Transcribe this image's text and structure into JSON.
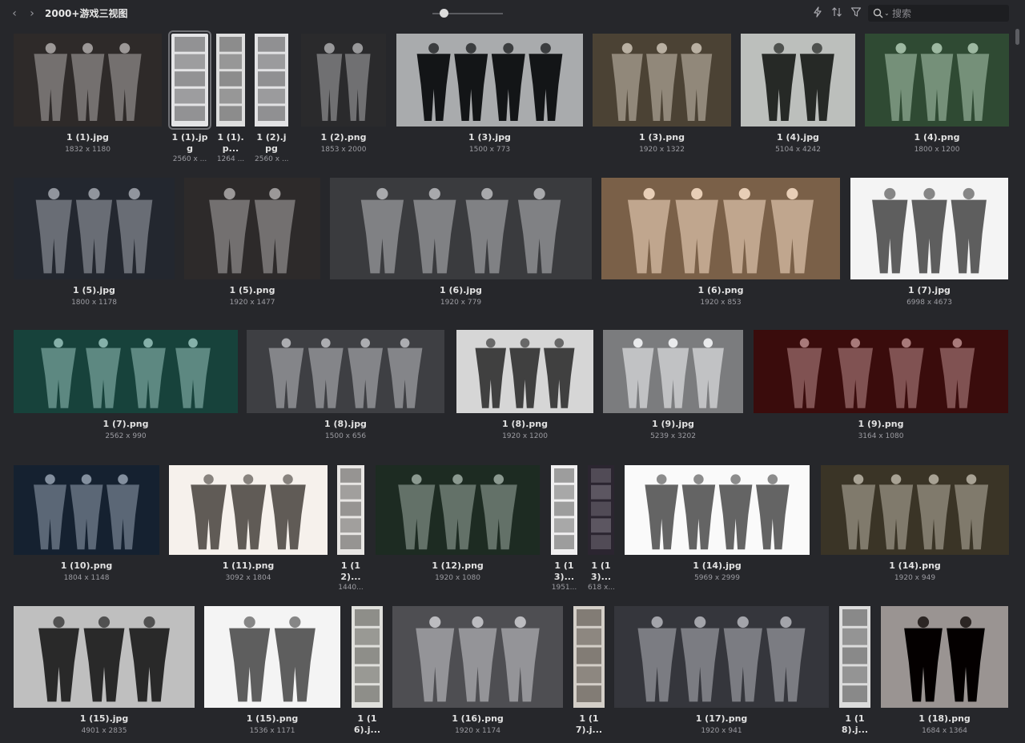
{
  "header": {
    "back_icon": "chevron-left-icon",
    "forward_icon": "chevron-right-icon",
    "folder_title": "2000+游戏三视图",
    "tools": [
      "lightning-icon",
      "sort-icon",
      "filter-icon"
    ],
    "search_placeholder": "搜索"
  },
  "thumbnail_size": 0.1,
  "rows": [
    [
      {
        "name": "1 (1).jpg",
        "dims": "1832 x 1180",
        "bg": "#2e2a29"
      },
      {
        "name": "1 (1).jpg",
        "dims": "2560 x ...",
        "bg": "#e4e4e6",
        "selected": true
      },
      {
        "name": "1 (1).p...",
        "dims": "1264 ...",
        "bg": "#dedede"
      },
      {
        "name": "1 (2).jpg",
        "dims": "2560 x ...",
        "bg": "#e2e2e4"
      },
      {
        "name": "1 (2).png",
        "dims": "1853 x 2000",
        "bg": "#2a2a2c"
      },
      {
        "name": "1 (3).jpg",
        "dims": "1500 x 773",
        "bg": "#a9abad"
      },
      {
        "name": "1 (3).png",
        "dims": "1920 x 1322",
        "bg": "#4b4234"
      },
      {
        "name": "1 (4).jpg",
        "dims": "5104 x 4242",
        "bg": "#bcbfbc"
      },
      {
        "name": "1 (4).png",
        "dims": "1800 x 1200",
        "bg": "#2f4a33"
      }
    ],
    [
      {
        "name": "1 (5).jpg",
        "dims": "1800 x 1178",
        "bg": "#23272f"
      },
      {
        "name": "1 (5).png",
        "dims": "1920 x 1477",
        "bg": "#2d2a2a"
      },
      {
        "name": "1 (6).jpg",
        "dims": "1920 x 779",
        "bg": "#3a3b3e"
      },
      {
        "name": "1 (6).png",
        "dims": "1920 x 853",
        "bg": "#7a6048"
      },
      {
        "name": "1 (7).jpg",
        "dims": "6998 x 4673",
        "bg": "#f4f4f4"
      }
    ],
    [
      {
        "name": "1 (7).png",
        "dims": "2562 x 990",
        "bg": "#17423b"
      },
      {
        "name": "1 (8).jpg",
        "dims": "1500 x 656",
        "bg": "#3e3f43"
      },
      {
        "name": "1 (8).png",
        "dims": "1920 x 1200",
        "bg": "#d6d6d6"
      },
      {
        "name": "1 (9).jpg",
        "dims": "5239 x 3202",
        "bg": "#7b7c7e"
      },
      {
        "name": "1 (9).png",
        "dims": "3164 x 1080",
        "bg": "#3a0c0c"
      }
    ],
    [
      {
        "name": "1 (10).png",
        "dims": "1804 x 1148",
        "bg": "#152130"
      },
      {
        "name": "1 (11).png",
        "dims": "3092 x 1804",
        "bg": "#f6f1ec"
      },
      {
        "name": "1 (12)...",
        "dims": "1440...",
        "bg": "#e8e6e4"
      },
      {
        "name": "1 (12).png",
        "dims": "1920 x 1080",
        "bg": "#1d2b22"
      },
      {
        "name": "1 (13)...",
        "dims": "1951...",
        "bg": "#f0eff0"
      },
      {
        "name": "1 (13)...",
        "dims": "618 x...",
        "bg": "#2b2530"
      },
      {
        "name": "1 (14).jpg",
        "dims": "5969 x 2999",
        "bg": "#fafafa"
      },
      {
        "name": "1 (14).png",
        "dims": "1920 x 949",
        "bg": "#3a3426"
      }
    ],
    [
      {
        "name": "1 (15).jpg",
        "dims": "4901 x 2835",
        "bg": "#bfbfbf"
      },
      {
        "name": "1 (15).png",
        "dims": "1536 x 1171",
        "bg": "#f4f4f4"
      },
      {
        "name": "1 (16).j...",
        "dims": "",
        "bg": "#e0e0dc"
      },
      {
        "name": "1 (16).png",
        "dims": "1920 x 1174",
        "bg": "#4e4e52"
      },
      {
        "name": "1 (17).j...",
        "dims": "",
        "bg": "#d4cfc8"
      },
      {
        "name": "1 (17).png",
        "dims": "1920 x 941",
        "bg": "#35363c"
      },
      {
        "name": "1 (18).j...",
        "dims": "",
        "bg": "#dcdcdc"
      },
      {
        "name": "1 (18).png",
        "dims": "1684 x 1364",
        "bg": "#9a9492"
      }
    ]
  ]
}
